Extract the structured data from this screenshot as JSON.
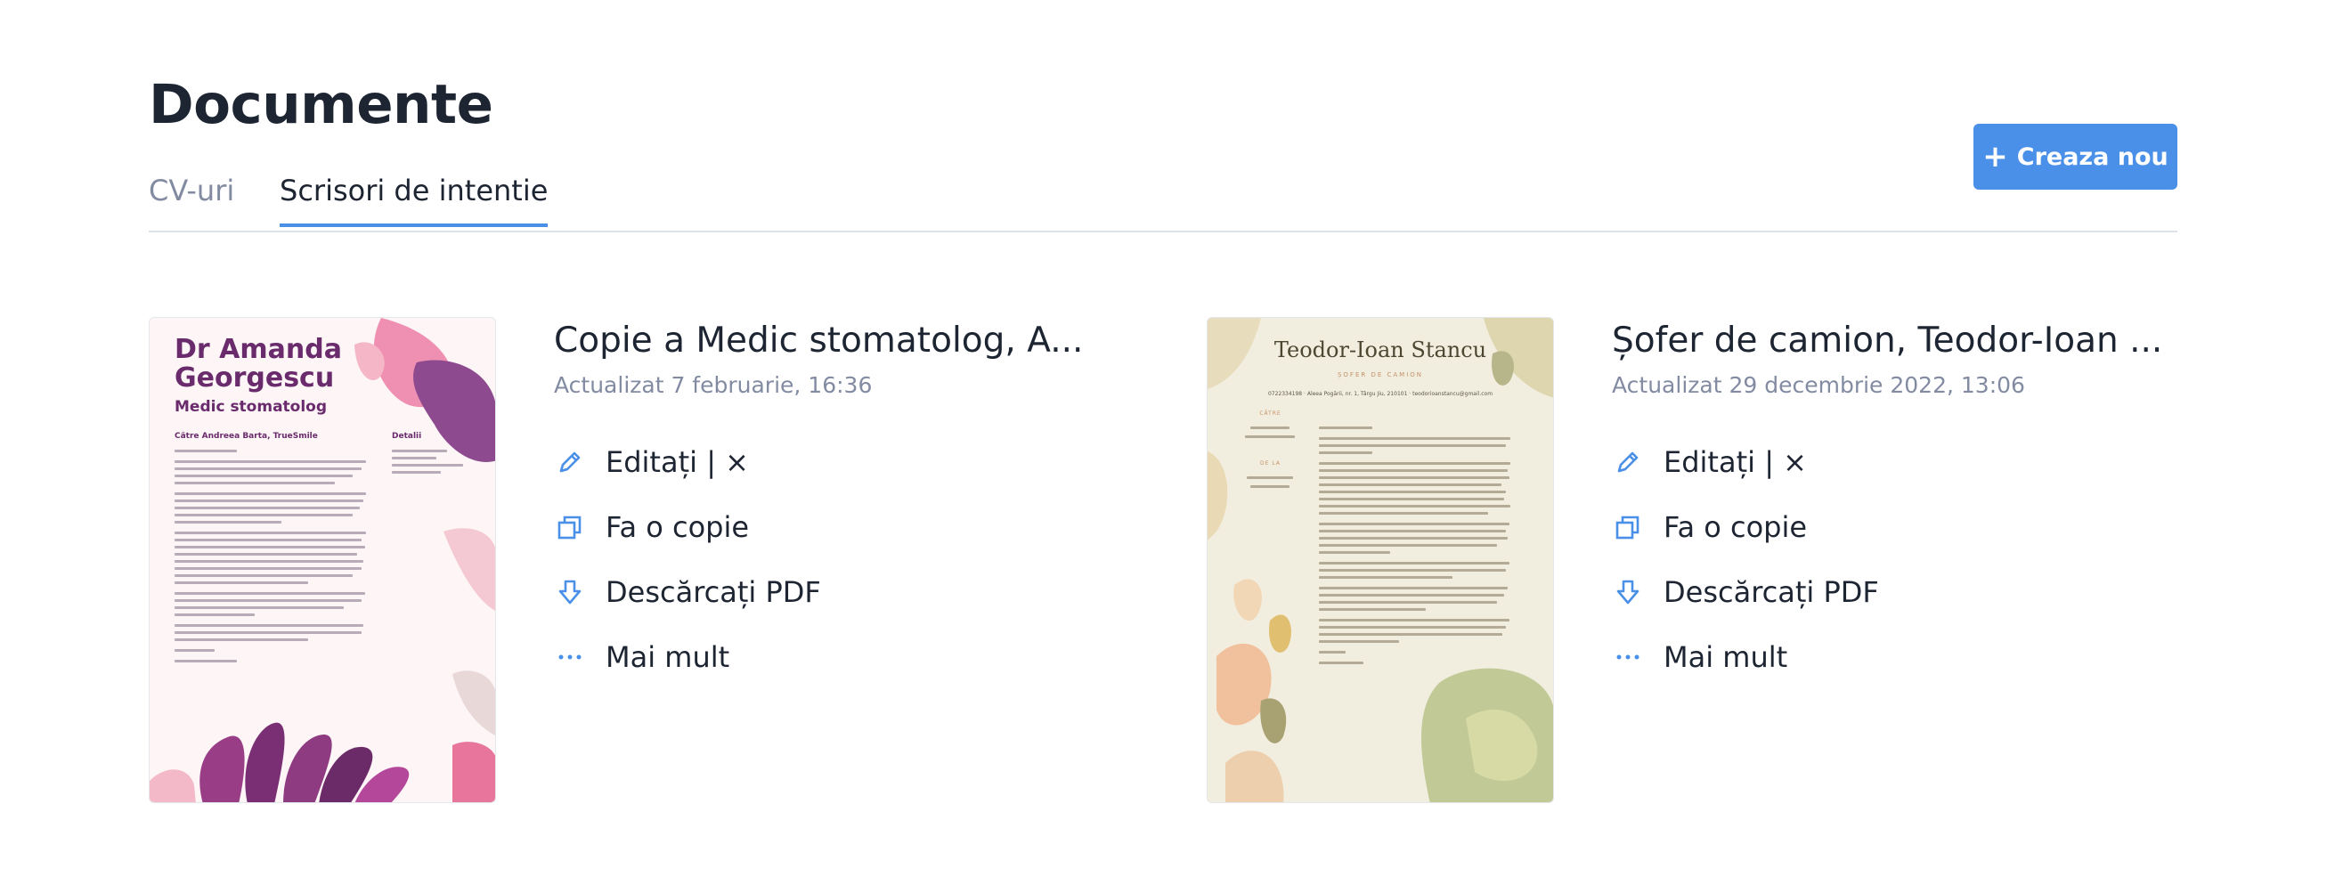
{
  "page": {
    "title": "Documente",
    "create_button": "Creaza nou"
  },
  "tabs": [
    {
      "label": "CV-uri",
      "active": false
    },
    {
      "label": "Scrisori de intentie",
      "active": true
    }
  ],
  "documents": [
    {
      "title": "Copie a Medic stomatolog, A...",
      "updated": "Actualizat 7 februarie, 16:36",
      "thumbnail": {
        "name": "Dr Amanda Georgescu",
        "job": "Medic stomatolog",
        "to": "Către Andreea Barta, TrueSmile",
        "details": "Detalii"
      }
    },
    {
      "title": "Șofer de camion, Teodor-Ioan ...",
      "updated": "Actualizat 29 decembrie 2022, 13:06",
      "thumbnail": {
        "name": "Teodor-Ioan Stancu",
        "job": "ȘOFER DE CAMION",
        "contact": "0722334198 · Aleea Pogării, nr. 1, Târgu Jiu, 210101 · teodorioanstancu@gmail.com",
        "to_label": "CĂTRE",
        "from_label": "DE LA"
      }
    }
  ],
  "actions": {
    "edit": "Editați | ×",
    "copy": "Fa o copie",
    "download": "Descărcați PDF",
    "more": "Mai mult"
  },
  "colors": {
    "accent": "#4a90e8",
    "text": "#1e2532",
    "muted": "#828ba2"
  },
  "icons": {
    "create": "plus-icon",
    "edit": "pencil-icon",
    "copy": "copy-icon",
    "download": "download-icon",
    "more": "dots-icon"
  }
}
